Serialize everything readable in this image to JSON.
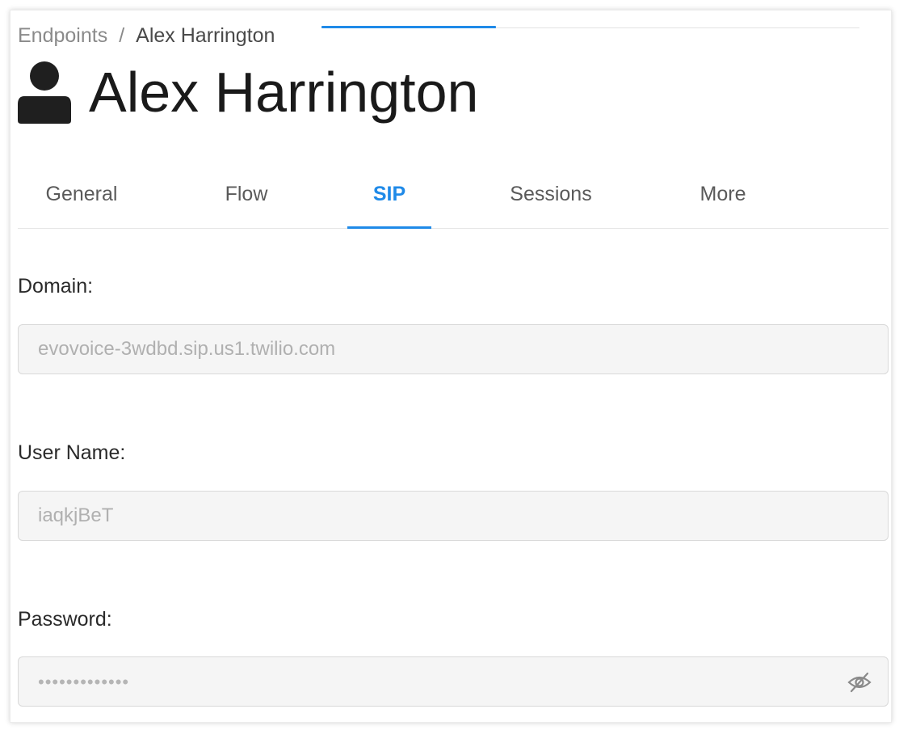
{
  "breadcrumb": {
    "parent": "Endpoints",
    "separator": "/",
    "current": "Alex Harrington"
  },
  "page": {
    "title": "Alex Harrington",
    "title_icon": "user-icon"
  },
  "tabs": [
    {
      "label": "General",
      "active": false
    },
    {
      "label": "Flow",
      "active": false
    },
    {
      "label": "SIP",
      "active": true
    },
    {
      "label": "Sessions",
      "active": false
    },
    {
      "label": "More",
      "active": false
    }
  ],
  "fields": {
    "domain": {
      "label": "Domain",
      "value": "evovoice-3wdbd.sip.us1.twilio.com"
    },
    "user_name": {
      "label": "User Name",
      "value": "iaqkjBeT"
    },
    "password": {
      "label": "Password",
      "masked_value": "•••••••••••••",
      "toggle_icon": "eye-slash-icon"
    }
  },
  "colors": {
    "accent": "#1f8ae8",
    "title": "#1a1a1a",
    "input_bg": "#f5f5f5",
    "input_border": "#d9d9d9"
  }
}
